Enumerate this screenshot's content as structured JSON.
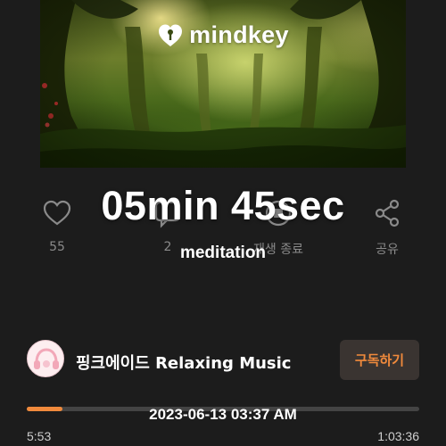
{
  "video": {
    "logo_text": "mindkey",
    "logo_icon": "heart-key-icon"
  },
  "actions": {
    "like": {
      "icon": "heart-outline-icon",
      "label": "55"
    },
    "comment": {
      "icon": "comment-icon",
      "label": "2"
    },
    "stop": {
      "icon": "stop-icon",
      "label": "재생 종료"
    },
    "share": {
      "icon": "share-icon",
      "label": "공유"
    }
  },
  "overlay": {
    "duration_text": "05min 45sec",
    "category_text": "meditation",
    "date_text": "2023-06-13 03:37 AM"
  },
  "channel": {
    "name": "핑크에이드 Relaxing Music",
    "subscribe_label": "구독하기",
    "avatar_icon": "headphones-avatar-icon"
  },
  "player": {
    "current_time": "5:53",
    "total_time": "1:03:36",
    "progress_fraction": 0.092,
    "accent_color": "#f08a3c"
  }
}
